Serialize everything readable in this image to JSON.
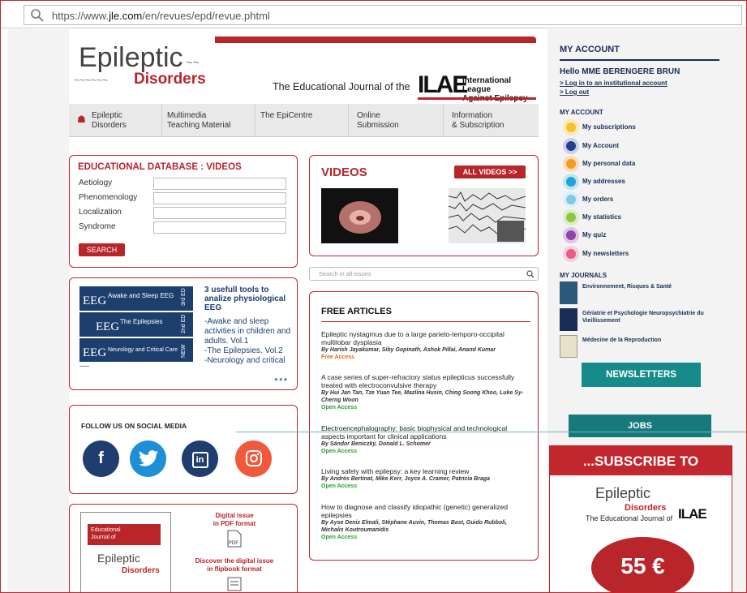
{
  "browser": {
    "url_prefix": "https://www.",
    "url_domain": "jle.com",
    "url_suffix": "/en/revues/epd/revue.phtml"
  },
  "header": {
    "logo_top": "Epileptic",
    "logo_bottom": "Disorders",
    "tagline": "The Educational Journal of the",
    "ilae_mark": "ILAE",
    "ilae_line1": "International League",
    "ilae_line2": "Against Epilepsy"
  },
  "nav": [
    {
      "line1": "Epileptic",
      "line2": "Disorders"
    },
    {
      "line1": "Multimedia",
      "line2": "Teaching Material"
    },
    {
      "line1": "The EpiCentre",
      "line2": ""
    },
    {
      "line1": "Online",
      "line2": "Submission"
    },
    {
      "line1": "Information",
      "line2": "& Subscription"
    }
  ],
  "edu": {
    "title": "EDUCATIONAL DATABASE : VIDEOS",
    "fields": [
      "Aetiology",
      "Phenomenology",
      "Localization",
      "Syndrome"
    ],
    "search_label": "SEARCH"
  },
  "videos": {
    "title": "VIDEOS",
    "all_label": "ALL VIDEOS  >>"
  },
  "slider": {
    "title": "3 usefull tools to analize physiological EEG",
    "items": [
      "-Awake and sleep activities in children and adults. Vol.1",
      "-The Epilepsies. Vol.2",
      "-Neurology and critical"
    ],
    "dash": "----",
    "book_labels": [
      "EEG",
      "Awake and Sleep EEG",
      "EEG",
      "The Epilepsies",
      "EEG",
      "Neurology and Critical Care",
      "3rd ED",
      "2nd ED",
      "NEW"
    ]
  },
  "search_issues": {
    "placeholder": "Search in all issues"
  },
  "free_articles": {
    "title": "FREE ARTICLES",
    "items": [
      {
        "title": "Epileptic nystagmus due to a large parieto-temporo-occipital multilobar dysplasia",
        "authors": "By Harish Jayakumar, Siby Gopinath, Ashok Pillai, Anand Kumar",
        "access": "Free Access"
      },
      {
        "title": "A case series of super-refractory status epilepticus successfully treated with electroconvulsive therapy",
        "authors": "By Hui Jan Tan, Tze Yuan Tee, Mazlina Husin, Ching Soong Khoo, Luke Sy-Cherng Woon",
        "access": "Open Access"
      },
      {
        "title": "Electroencephalography: basic biophysical and technological aspects important for clinical applications",
        "authors": "By Sándor Beniczky, Donald L. Schomer",
        "access": "Open Access"
      },
      {
        "title": "Living safely with epilepsy: a key learning review",
        "authors": "By Andrés Bertinat, Mike Kerr, Joyce A. Cramer, Patricia Braga",
        "access": "Open Access"
      },
      {
        "title": "How to diagnose and classify idiopathic (genetic) generalized epilepsies",
        "authors": "By Ayse Deniz Elmali, Stéphane Auvin, Thomas Bast, Guido Rubboli, Michalis Koutroumanidis",
        "access": "Open Access"
      }
    ]
  },
  "social": {
    "title": "FOLLOW US ON SOCIAL MEDIA",
    "icons": [
      "f",
      "t",
      "in",
      "ig"
    ]
  },
  "digital": {
    "issue_line1": "Digital issue",
    "issue_line2": "in PDF format",
    "flip_line1": "Discover the digital issue",
    "flip_line2": "in flipbook format",
    "cover_line1": "Educational",
    "cover_line2": "Journal of",
    "cover_logo1": "Epileptic",
    "cover_logo2": "Disorders"
  },
  "account": {
    "title": "MY ACCOUNT",
    "hello": "Hello MME BERENGERE BRUN",
    "login_link": "> Log in to an institutional account",
    "logout_link": "> Log out",
    "sub_title": "MY ACCOUNT",
    "items": [
      {
        "label": "My subscriptions",
        "icon": "subscriptions-icon",
        "color": "#f2c230"
      },
      {
        "label": "My Account",
        "icon": "account-icon",
        "color": "#25408f"
      },
      {
        "label": "My personal data",
        "icon": "personal-data-icon",
        "color": "#f39c1f"
      },
      {
        "label": "My addresses",
        "icon": "addresses-icon",
        "color": "#1fa3d9"
      },
      {
        "label": "My orders",
        "icon": "orders-icon",
        "color": "#7fcbe3"
      },
      {
        "label": "My statistics",
        "icon": "statistics-icon",
        "color": "#8cc63f"
      },
      {
        "label": "My quiz",
        "icon": "quiz-icon",
        "color": "#8e44ad"
      },
      {
        "label": "My newsletters",
        "icon": "newsletters-icon",
        "color": "#e85a8a"
      }
    ],
    "journals_title": "MY JOURNALS",
    "journals": [
      "Environnement, Risques & Santé",
      "Gériatrie et Psychologie Neuropsychiatrie du Vieillissement",
      "Médecine de la Reproduction"
    ],
    "newsletters_btn": "NEWSLETTERS"
  },
  "jobs_btn": "JOBS",
  "subscribe": {
    "heading": "...SUBSCRIBE TO",
    "logo1": "Epileptic",
    "logo2": "Disorders",
    "tagline": "The Educational Journal of",
    "price": "55 €"
  }
}
